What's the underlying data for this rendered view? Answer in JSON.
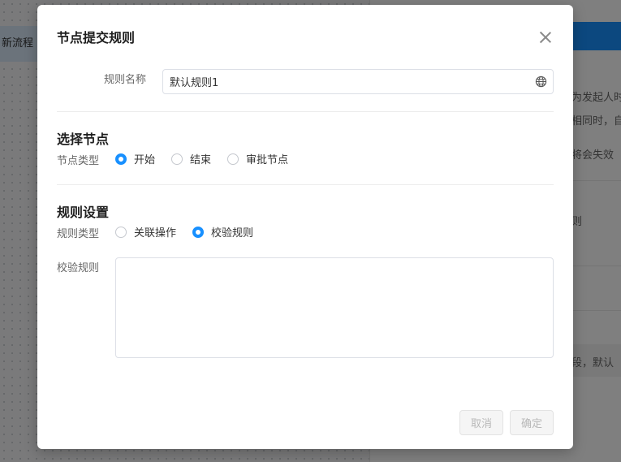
{
  "background": {
    "flow_label": "新流程",
    "panel_lines": [
      "为发起人时",
      "相同时，自",
      "将会失效",
      "则",
      "段，默认"
    ]
  },
  "modal": {
    "title": "节点提交规则",
    "rule_name": {
      "label": "规则名称",
      "value": "默认规则1"
    },
    "select_node": {
      "title": "选择节点",
      "type_label": "节点类型",
      "options": [
        {
          "label": "开始",
          "checked": true
        },
        {
          "label": "结束",
          "checked": false
        },
        {
          "label": "审批节点",
          "checked": false
        }
      ]
    },
    "rule_settings": {
      "title": "规则设置",
      "type_label": "规则类型",
      "options": [
        {
          "label": "关联操作",
          "checked": false
        },
        {
          "label": "校验规则",
          "checked": true
        }
      ],
      "validation_label": "校验规则",
      "validation_value": ""
    },
    "cancel_label": "取消",
    "confirm_label": "确定"
  },
  "colors": {
    "accent": "#1890ff",
    "overlay": "rgba(0,0,0,0.5)"
  }
}
